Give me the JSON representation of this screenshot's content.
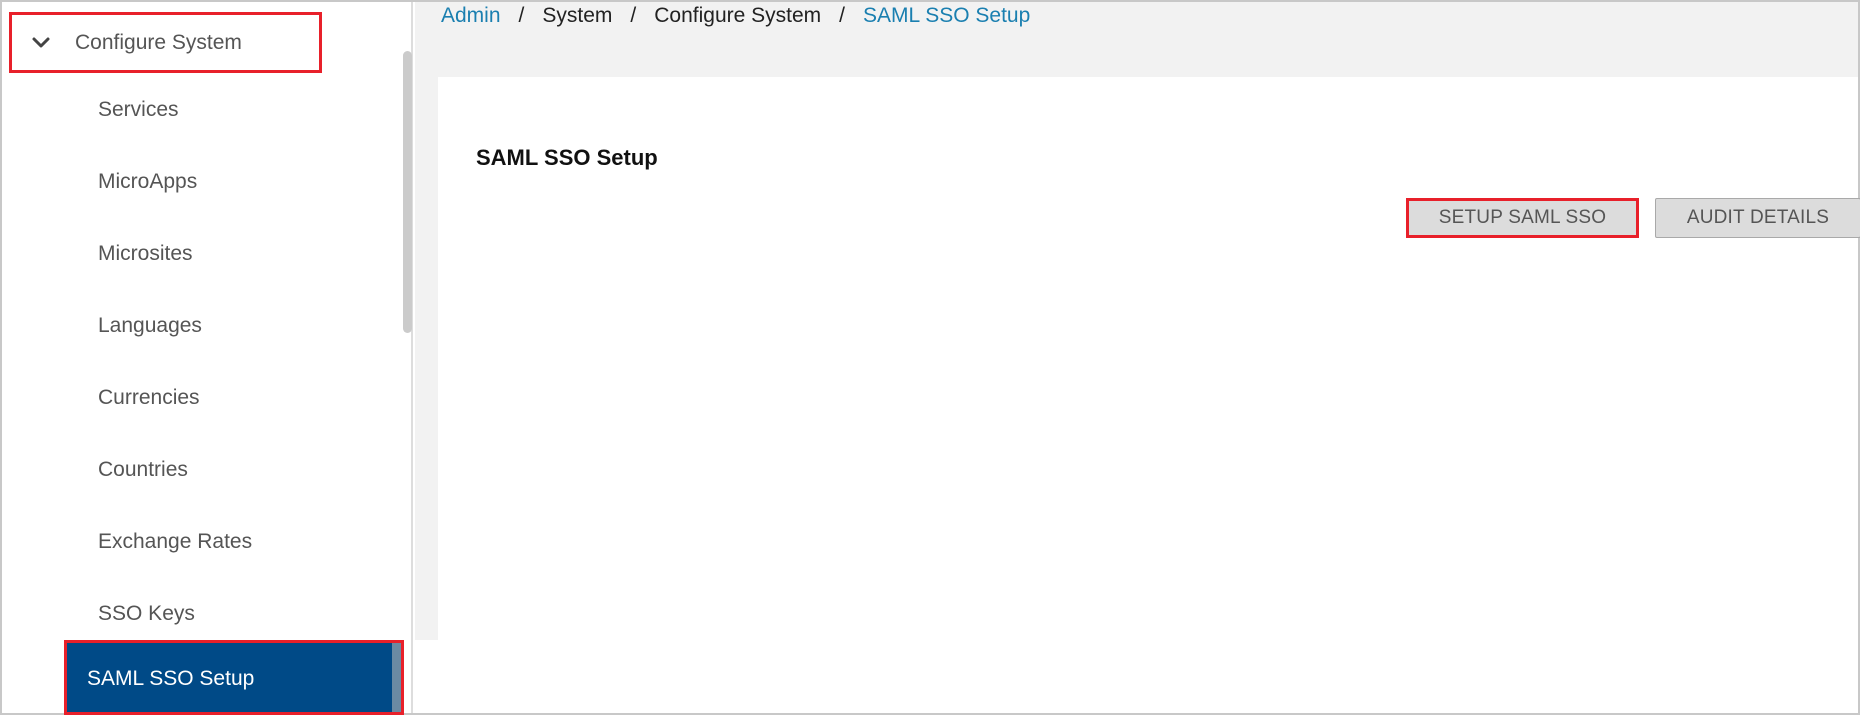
{
  "sidebar": {
    "group": {
      "label": "Configure System",
      "expanded": true,
      "icon": "chevron-down-icon"
    },
    "items": [
      {
        "label": "Services"
      },
      {
        "label": "MicroApps"
      },
      {
        "label": "Microsites"
      },
      {
        "label": "Languages"
      },
      {
        "label": "Currencies"
      },
      {
        "label": "Countries"
      },
      {
        "label": "Exchange Rates"
      },
      {
        "label": "SSO Keys"
      },
      {
        "label": "SAML SSO Setup",
        "selected": true
      }
    ]
  },
  "breadcrumb": [
    {
      "label": "Admin",
      "link": true
    },
    {
      "label": "/"
    },
    {
      "label": "System",
      "link": false
    },
    {
      "label": "/"
    },
    {
      "label": "Configure System",
      "link": false
    },
    {
      "label": "/"
    },
    {
      "label": "SAML SSO Setup",
      "link": true
    }
  ],
  "main": {
    "title": "SAML SSO Setup",
    "buttons": {
      "setup": "SETUP SAML SSO",
      "audit": "AUDIT DETAILS"
    }
  },
  "colors": {
    "highlight_border": "#e8202a",
    "selected_bg": "#004a87",
    "link": "#1a7fb0",
    "button_bg": "#dcdcdc"
  }
}
